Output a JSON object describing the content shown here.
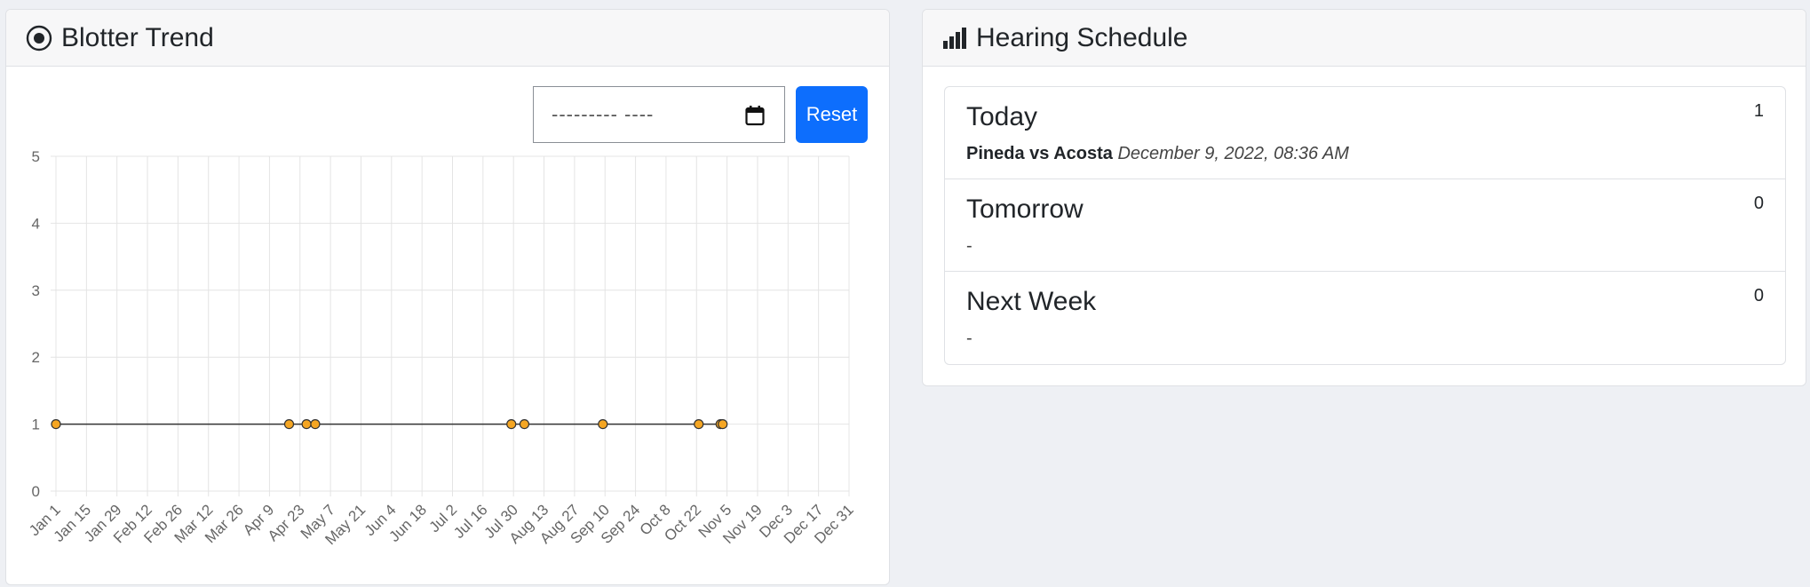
{
  "blotter": {
    "title": "Blotter Trend",
    "date_placeholder": "--------- ----",
    "reset_label": "Reset"
  },
  "hearing": {
    "title": "Hearing Schedule",
    "items": [
      {
        "label": "Today",
        "count": "1",
        "case": "Pineda vs Acosta",
        "datetime": "December 9, 2022, 08:36 AM"
      },
      {
        "label": "Tomorrow",
        "count": "0",
        "empty": "-"
      },
      {
        "label": "Next Week",
        "count": "0",
        "empty": "-"
      }
    ]
  },
  "chart_data": {
    "type": "line",
    "title": "",
    "xlabel": "",
    "ylabel": "",
    "ylim": [
      0,
      5
    ],
    "yticks": [
      "0",
      "1",
      "2",
      "3",
      "4",
      "5"
    ],
    "xlim": [
      "2022-01-01",
      "2022-12-31"
    ],
    "xticks": [
      "Jan 1",
      "Jan 15",
      "Jan 29",
      "Feb 12",
      "Feb 26",
      "Mar 12",
      "Mar 26",
      "Apr 9",
      "Apr 23",
      "May 7",
      "May 21",
      "Jun 4",
      "Jun 18",
      "Jul 2",
      "Jul 16",
      "Jul 30",
      "Aug 13",
      "Aug 27",
      "Sep 10",
      "Sep 24",
      "Oct 8",
      "Oct 22",
      "Nov 5",
      "Nov 19",
      "Dec 3",
      "Dec 17",
      "Dec 31"
    ],
    "grid": true,
    "line_color": "#333333",
    "point_color": "#f5a623",
    "series": [
      {
        "x": [
          "2022-01-01",
          "2022-04-18",
          "2022-04-26",
          "2022-04-30",
          "2022-07-29",
          "2022-08-04",
          "2022-09-09",
          "2022-10-23",
          "2022-11-02",
          "2022-11-03"
        ],
        "y": [
          1,
          1,
          1,
          1,
          1,
          1,
          1,
          1,
          1,
          1
        ]
      }
    ]
  }
}
